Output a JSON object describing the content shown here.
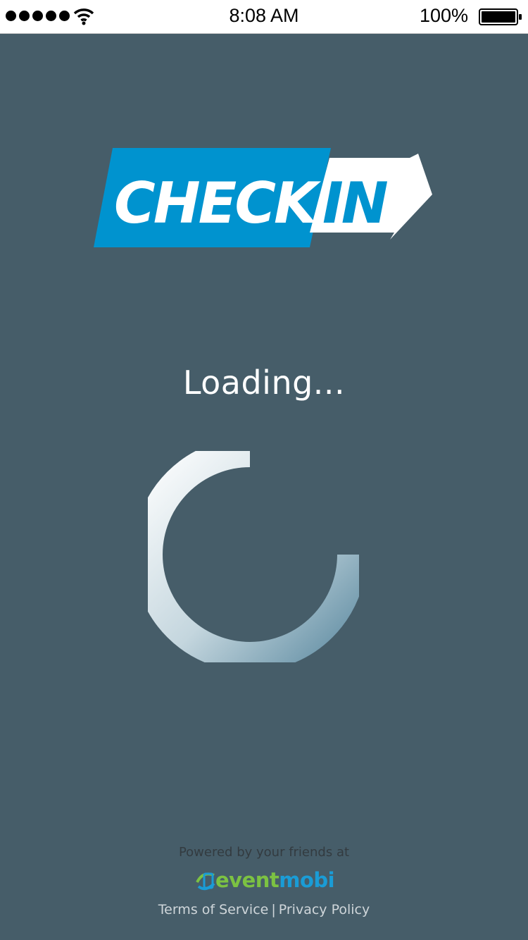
{
  "status_bar": {
    "time": "8:08 AM",
    "battery_percent": "100%",
    "signal_bars": 5,
    "icons": [
      "signal-dots-icon",
      "wifi-icon",
      "battery-icon"
    ]
  },
  "logo": {
    "word_left": "CHECK",
    "word_right": "IN",
    "colors": {
      "accent": "#0093cf",
      "background": "#465d69",
      "text": "#ffffff"
    }
  },
  "loading": {
    "text": "Loading..."
  },
  "footer": {
    "powered_by": "Powered by your friends at",
    "brand_a": "event",
    "brand_b": "mobi",
    "terms": "Terms of Service",
    "separator": "|",
    "privacy": "Privacy Policy"
  }
}
